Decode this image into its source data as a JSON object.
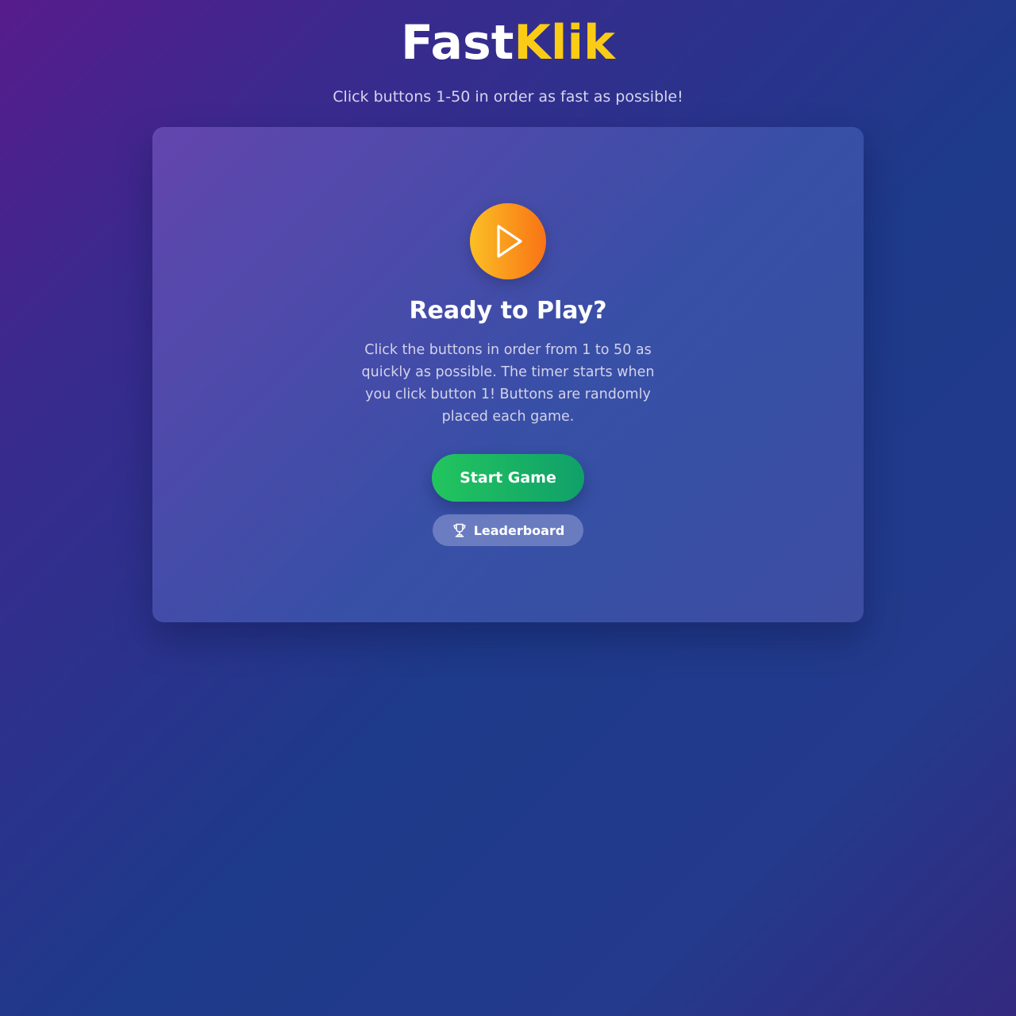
{
  "header": {
    "brand_part_a": "Fast",
    "brand_part_b": "Klik",
    "subtitle": "Click buttons 1-50 in order as fast as possible!"
  },
  "start_screen": {
    "icon": "play-icon",
    "title": "Ready to Play?",
    "instructions": "Click the buttons in order from 1 to 50 as quickly as possible. The timer starts when you click button 1! Buttons are randomly placed each game.",
    "start_button_label": "Start Game",
    "leaderboard_button_label": "Leaderboard",
    "leaderboard_icon": "trophy-icon"
  },
  "colors": {
    "brand_accent": "#facc15",
    "start_button": "#22c55e",
    "play_badge_start": "#fbbf24",
    "play_badge_end": "#f97316"
  }
}
